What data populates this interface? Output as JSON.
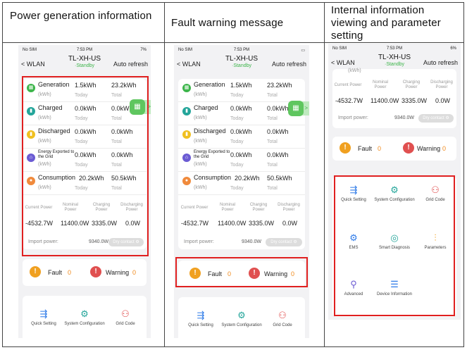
{
  "captions": {
    "col1": "Power generation information",
    "col2": "Fault warning message",
    "col3": "Internal information viewing and parameter setting"
  },
  "phones": [
    {
      "status": {
        "carrier": "No SIM",
        "time": "7:53 PM",
        "battery": "7%"
      }
    },
    {
      "status": {
        "carrier": "No SIM",
        "time": "7:53 PM",
        "battery": ""
      }
    },
    {
      "status": {
        "carrier": "No SIM",
        "time": "7:53 PM",
        "battery": "6%"
      }
    }
  ],
  "nav": {
    "back": "WLAN",
    "title": "TL-XH-US",
    "subtitle": "·Standby",
    "auto_refresh": "Auto refresh"
  },
  "energy": {
    "unit": "(kWh)",
    "today": "Today",
    "total": "Total",
    "rows": [
      {
        "label": "Generation",
        "today": "1.5kWh",
        "total": "23.2kWh",
        "icon": "generation-icon",
        "color": "#3cb54a"
      },
      {
        "label": "Charged",
        "today": "0.0kWh",
        "total": "0.0kWh",
        "icon": "battery-charged-icon",
        "color": "#24a59a"
      },
      {
        "label": "Discharged",
        "today": "0.0kWh",
        "total": "0.0kWh",
        "icon": "battery-discharged-icon",
        "color": "#f0c020"
      },
      {
        "label": "Energy Exported to the Grid",
        "today": "0.0kWh",
        "total": "0.0kWh",
        "icon": "grid-export-icon",
        "color": "#6b5bd3"
      },
      {
        "label": "Consumption",
        "today": "20.2kWh",
        "total": "50.5kWh",
        "icon": "consumption-icon",
        "color": "#f08a3c"
      }
    ],
    "alt": {
      "consumption_today": "20.2kWh",
      "consumption_total": "50.5kWh"
    }
  },
  "power": {
    "labels": [
      "Current Power",
      "Nominal Power",
      "Charging Power",
      "Discharging Power"
    ],
    "values": [
      "-4532.7W",
      "11400.0W",
      "3335.0W",
      "0.0W"
    ],
    "import_label": "Import power:",
    "import_value": "9340.0W",
    "dry_contact": "Dry contact"
  },
  "alerts": {
    "fault": "Fault",
    "fault_count": "0",
    "warning": "Warning",
    "warning_count": "0"
  },
  "tiles": [
    {
      "label": "Quick Setting",
      "icon": "quick-setting-icon"
    },
    {
      "label": "System Configuration",
      "icon": "system-configuration-icon"
    },
    {
      "label": "Grid Code",
      "icon": "grid-code-icon"
    },
    {
      "label": "EMS",
      "icon": "ems-icon"
    },
    {
      "label": "Smart Diagnosis",
      "icon": "smart-diagnosis-icon"
    },
    {
      "label": "Parameters",
      "icon": "parameters-icon"
    },
    {
      "label": "Advanced",
      "icon": "advanced-icon"
    },
    {
      "label": "Device Information",
      "icon": "device-information-icon"
    }
  ],
  "partial_unit": "(kWh)"
}
